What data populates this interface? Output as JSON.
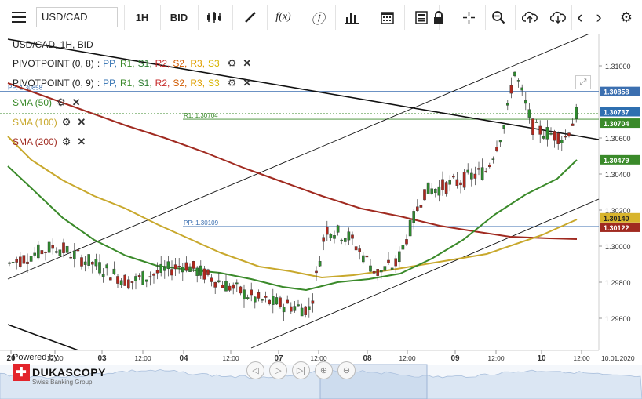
{
  "toolbar": {
    "menu_icon": "hamburger-menu-icon",
    "symbol": "USD/CAD",
    "timeframe": "1H",
    "price_side": "BID",
    "items": [
      {
        "name": "chart-type-icon",
        "glyph": "▌▎▌"
      },
      {
        "name": "draw-line-icon",
        "glyph": "╱"
      },
      {
        "name": "function-icon",
        "glyph": "f(x)"
      },
      {
        "name": "info-icon",
        "glyph": "ⓘ"
      },
      {
        "name": "volume-bars-icon",
        "glyph": "▁▃▅"
      },
      {
        "name": "calendar-icon",
        "glyph": "▦"
      },
      {
        "name": "news-icon",
        "glyph": "▤"
      },
      {
        "name": "lock-icon",
        "glyph": "🔒"
      },
      {
        "name": "crosshair-icon",
        "glyph": "⌖"
      },
      {
        "name": "zoom-icon",
        "glyph": "⊖"
      },
      {
        "name": "upload-icon",
        "glyph": "☁"
      },
      {
        "name": "download-icon",
        "glyph": "☁"
      },
      {
        "name": "prev-icon",
        "glyph": "‹"
      },
      {
        "name": "next-icon",
        "glyph": "›"
      },
      {
        "name": "settings-gear-icon",
        "glyph": "⚙"
      }
    ]
  },
  "legend": {
    "title": "USD/CAD, 1H, BID",
    "pivot1": "PIVOTPOINT (0, 8)",
    "pivot2": "PIVOTPOINT (0, 9)",
    "pivot_levels": [
      {
        "label": "PP,",
        "color": "#2f6fb0"
      },
      {
        "label": "R1,",
        "color": "#3a8a2a"
      },
      {
        "label": "S1,",
        "color": "#2e7d32"
      },
      {
        "label": "R2,",
        "color": "#c62828"
      },
      {
        "label": "S2,",
        "color": "#d05a00"
      },
      {
        "label": "R3,",
        "color": "#e0a000"
      },
      {
        "label": "S3",
        "color": "#d6b400"
      }
    ],
    "sma50": "SMA (50)",
    "sma100": "SMA (100)",
    "sma200": "SMA (200)",
    "sma50_color": "#3a8a2a",
    "sma100_color": "#c8a82c",
    "sma200_color": "#a02a20"
  },
  "chart_labels": {
    "pp_upper": "PP: 1.30858",
    "r1_label": "R1: 1.30704",
    "pp_lower": "PP: 1.30109"
  },
  "price_axis": {
    "ticks": [
      "1.31000",
      "1.30600",
      "1.30400",
      "1.30200",
      "1.30000",
      "1.29800",
      "1.29600"
    ],
    "tag_pp": "1.30858",
    "tag_current": "1.30737",
    "tag_r1": "1.30704",
    "tag_sma50": "1.30479",
    "tag_sma100": "1.30140",
    "tag_sma200": "1.30122"
  },
  "time_axis": {
    "labels": [
      "20",
      "12:00",
      "03",
      "12:00",
      "04",
      "12:00",
      "07",
      "12:00",
      "08",
      "12:00",
      "09",
      "12:00",
      "10",
      "12:00"
    ],
    "last_date": "10.01.2020"
  },
  "logo": {
    "powered": "Powered by",
    "brand": "DUKASCOPY",
    "sub": "Swiss Banking Group"
  },
  "nav_controls": [
    "◁",
    "▷",
    "▷|",
    "⊕",
    "⊖"
  ]
}
